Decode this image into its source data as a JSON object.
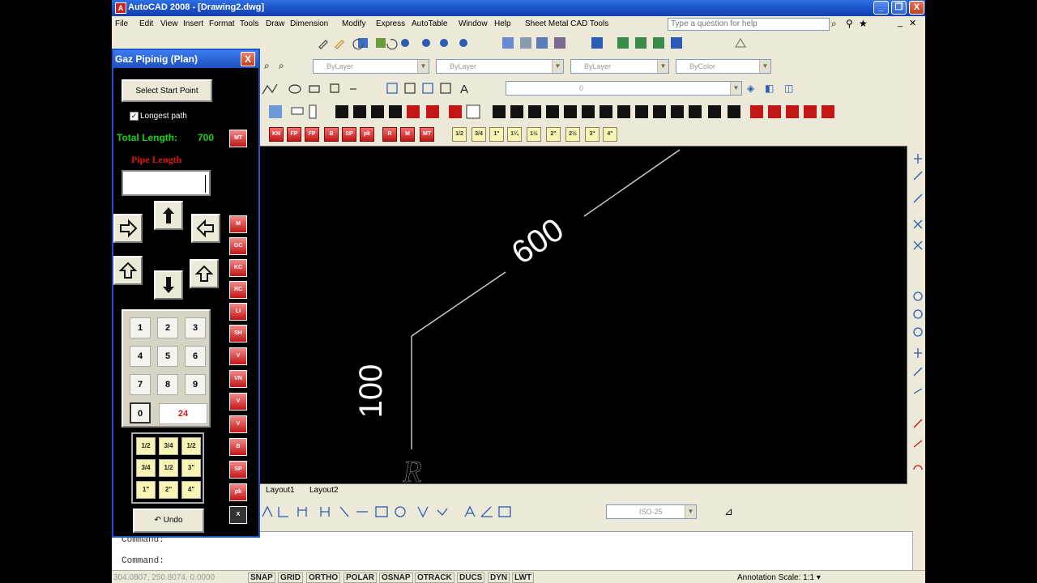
{
  "window": {
    "title": "AutoCAD 2008 - [Drawing2.dwg]",
    "minimize": "_",
    "restore": "❐",
    "close": "X"
  },
  "menu": {
    "items": [
      "File",
      "Edit",
      "View",
      "Insert",
      "Format",
      "Tools",
      "Draw",
      "Dimension",
      "Modify",
      "Express",
      "AutoTable",
      "Window",
      "Help",
      "Sheet Metal CAD Tools"
    ],
    "help_placeholder": "Type a question for help"
  },
  "layers": {
    "layer": "ByLayer",
    "linetype": "ByLayer",
    "lineweight": "ByLayer",
    "color": "ByColor",
    "current_layer": "0"
  },
  "toolbar_labels": {
    "fractions": [
      "1/2",
      "3/4",
      "1\"",
      "1¼",
      "1½",
      "2\"",
      "2½",
      "3\"",
      "4\""
    ],
    "pipe_tags": [
      "MT",
      "KN",
      "FP",
      "B",
      "SP",
      "pk",
      "R",
      "M",
      "MT"
    ]
  },
  "dim_style": "ISO-25",
  "layout_tabs": [
    "Layout1",
    "Layout2"
  ],
  "drawing": {
    "dim_horizontal": "600",
    "dim_vertical": "100",
    "start_marker": "R"
  },
  "command": {
    "line1": "Command:",
    "line2": "Command:"
  },
  "status": {
    "coords": "304.0807, 250.8074, 0.0000",
    "buttons": [
      "SNAP",
      "GRID",
      "ORTHO",
      "POLAR",
      "OSNAP",
      "OTRACK",
      "DUCS",
      "DYN",
      "LWT"
    ],
    "annotation_scale_label": "Annotation Scale:",
    "annotation_scale_value": "1:1"
  },
  "panel": {
    "title": "Gaz Pipinig (Plan)",
    "close": "X",
    "start_button": "Select Start Point",
    "longest_path_label": "Longest  path",
    "longest_path_checked": true,
    "total_length_label": "Total Length:",
    "total_length_value": "700",
    "total_btn": "MT",
    "pipe_length_label": "Pipe Length",
    "pipe_length_value": "",
    "numpad": [
      "1",
      "2",
      "3",
      "4",
      "5",
      "6",
      "7",
      "8",
      "9"
    ],
    "key_zero": "0",
    "key_display": "24",
    "fractions": [
      "1/2",
      "3/4",
      "1/2",
      "3/4",
      "1/2",
      "3\"",
      "1\"",
      "2\"",
      "4\""
    ],
    "undo": "Undo",
    "side_buttons": [
      "M",
      "GC",
      "KC",
      "RC",
      "LI",
      "SH",
      "V",
      "VN",
      "V",
      "V",
      "B",
      "SP",
      "pk",
      "X"
    ]
  },
  "colors": {
    "canvas": "#000000",
    "total_length": "#16d316",
    "pipe_label": "#e01414",
    "title_bar": "#1f53c8"
  }
}
